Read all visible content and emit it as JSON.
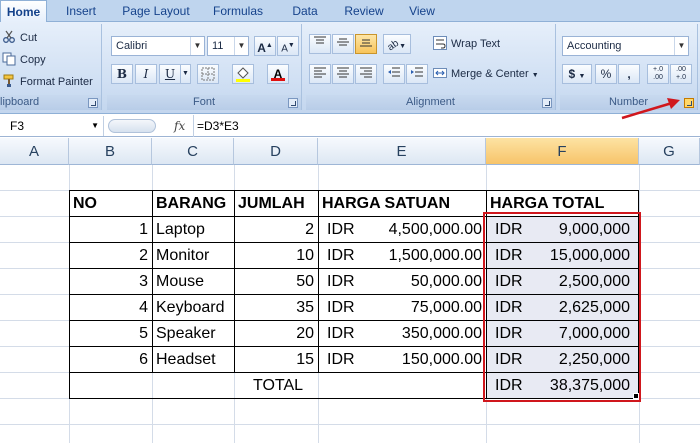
{
  "ribbon_tabs": [
    "Home",
    "Insert",
    "Page Layout",
    "Formulas",
    "Data",
    "Review",
    "View"
  ],
  "clipboard": {
    "cut": "Cut",
    "copy": "Copy",
    "format_painter": "Format Painter",
    "label": "lipboard"
  },
  "font": {
    "name": "Calibri",
    "size": "11",
    "grow": "A",
    "shrink": "A",
    "bold": "B",
    "italic": "I",
    "underline": "U",
    "font_color": "A",
    "label": "Font"
  },
  "alignment": {
    "wrap_text": "Wrap Text",
    "merge_center": "Merge & Center",
    "label": "Alignment"
  },
  "number": {
    "format": "Accounting",
    "currency": "$",
    "percent": "%",
    "comma": ",",
    "inc_decimal": "+.0 .00",
    "dec_decimal": ".00 +.0",
    "label": "Number"
  },
  "formula_bar": {
    "name_box": "F3",
    "fx": "fx",
    "formula": "=D3*E3"
  },
  "columns": [
    "A",
    "B",
    "C",
    "D",
    "E",
    "F",
    "G"
  ],
  "table": {
    "headers": {
      "no": "NO",
      "barang": "BARANG",
      "jumlah": "JUMLAH",
      "harga_satuan": "HARGA SATUAN",
      "harga_total": "HARGA TOTAL"
    },
    "currency": "IDR",
    "rows": [
      {
        "no": "1",
        "barang": "Laptop",
        "jumlah": "2",
        "harga_satuan": "4,500,000.00",
        "harga_total": "9,000,000"
      },
      {
        "no": "2",
        "barang": "Monitor",
        "jumlah": "10",
        "harga_satuan": "1,500,000.00",
        "harga_total": "15,000,000"
      },
      {
        "no": "3",
        "barang": "Mouse",
        "jumlah": "50",
        "harga_satuan": "50,000.00",
        "harga_total": "2,500,000"
      },
      {
        "no": "4",
        "barang": "Keyboard",
        "jumlah": "35",
        "harga_satuan": "75,000.00",
        "harga_total": "2,625,000"
      },
      {
        "no": "5",
        "barang": "Speaker",
        "jumlah": "20",
        "harga_satuan": "350,000.00",
        "harga_total": "7,000,000"
      },
      {
        "no": "6",
        "barang": "Headset",
        "jumlah": "15",
        "harga_satuan": "150,000.00",
        "harga_total": "2,250,000"
      }
    ],
    "total_label": "TOTAL",
    "total_value": "38,375,000"
  },
  "colors": {
    "selection_red": "#d0171d",
    "ribbon_blue": "#bfd5ee",
    "arrow_red": "#d0171d"
  }
}
